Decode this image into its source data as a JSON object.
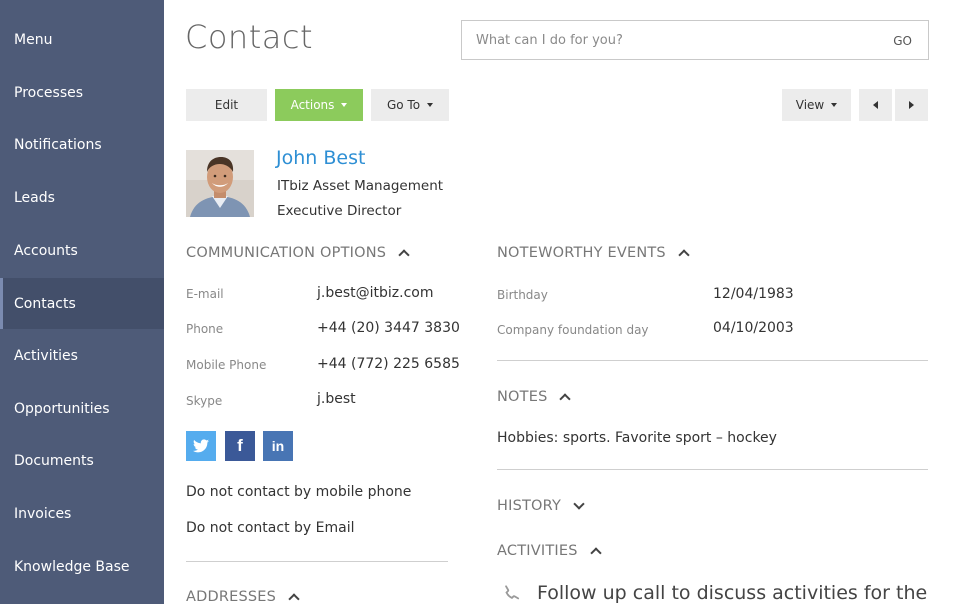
{
  "sidebar": {
    "items": [
      {
        "label": "Menu"
      },
      {
        "label": "Processes"
      },
      {
        "label": "Notifications"
      },
      {
        "label": "Leads"
      },
      {
        "label": "Accounts"
      },
      {
        "label": "Contacts",
        "active": true
      },
      {
        "label": "Activities"
      },
      {
        "label": "Opportunities"
      },
      {
        "label": "Documents"
      },
      {
        "label": "Invoices"
      },
      {
        "label": "Knowledge Base"
      }
    ]
  },
  "header": {
    "title": "Contact",
    "search_placeholder": "What can I do for you?",
    "search_go": "GO"
  },
  "toolbar": {
    "edit_label": "Edit",
    "actions_label": "Actions",
    "goto_label": "Go To",
    "view_label": "View"
  },
  "contact": {
    "name": "John Best",
    "company": "ITbiz Asset Management",
    "job_title": "Executive Director"
  },
  "communication": {
    "header": "COMMUNICATION OPTIONS",
    "fields": [
      {
        "label": "E-mail",
        "value": "j.best@itbiz.com"
      },
      {
        "label": "Phone",
        "value": "+44 (20) 3447 3830"
      },
      {
        "label": "Mobile Phone",
        "value": "+44 (772) 225 6585"
      },
      {
        "label": "Skype",
        "value": "j.best"
      }
    ],
    "social": [
      "twitter-icon",
      "facebook-icon",
      "linkedin-icon"
    ],
    "do_not_contact": [
      "Do not contact by mobile phone",
      "Do not contact by Email"
    ]
  },
  "addresses": {
    "header": "ADDRESSES"
  },
  "events": {
    "header": "NOTEWORTHY EVENTS",
    "items": [
      {
        "label": "Birthday",
        "value": "12/04/1983"
      },
      {
        "label": "Company foundation day",
        "value": "04/10/2003"
      }
    ]
  },
  "notes": {
    "header": "NOTES",
    "text": "Hobbies: sports. Favorite sport – hockey"
  },
  "history": {
    "header": "HISTORY"
  },
  "activities": {
    "header": "ACTIVITIES",
    "first_item": "Follow up call to discuss activities for the"
  },
  "colors": {
    "sidebar": "#4e5b78",
    "accent_green": "#8ccb5c",
    "link_blue": "#2e8fd4",
    "twitter": "#55acee",
    "facebook": "#3b5998",
    "linkedin": "#4875b4"
  }
}
